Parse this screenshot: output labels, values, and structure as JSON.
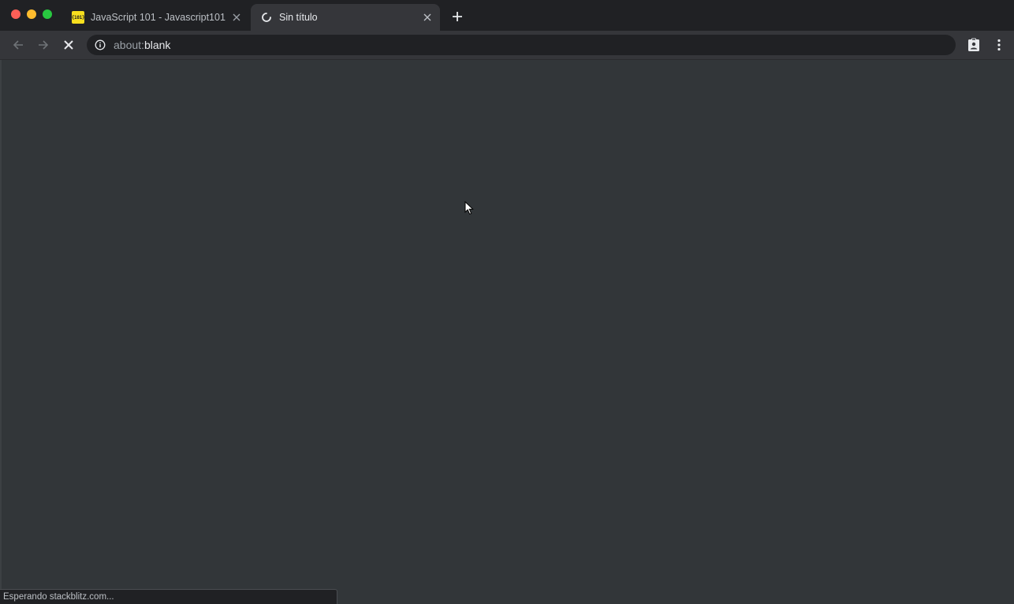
{
  "browser": {
    "tabs": [
      {
        "title": "JavaScript 101 - Javascript101",
        "favicon_text": "{101}",
        "favicon": "js101-logo-icon",
        "active": false
      },
      {
        "title": "Sin título",
        "favicon": "loading-spinner-icon",
        "active": true
      }
    ],
    "new_tab_icon": "plus-icon",
    "toolbar": {
      "back_icon": "arrow-left-icon",
      "forward_icon": "arrow-right-icon",
      "stop_icon": "close-icon",
      "info_icon": "info-circle-icon",
      "url_scheme": "about:",
      "url_rest": "blank",
      "profile_icon": "account-badge-icon",
      "menu_icon": "more-vert-icon"
    },
    "status_text": "Esperando stackblitz.com..."
  },
  "colors": {
    "tabstrip": "#202124",
    "toolbar": "#35363a",
    "content": "#323639",
    "omnibox": "#202124",
    "text": "#e8eaed",
    "favicon_yellow": "#f7df1e"
  }
}
